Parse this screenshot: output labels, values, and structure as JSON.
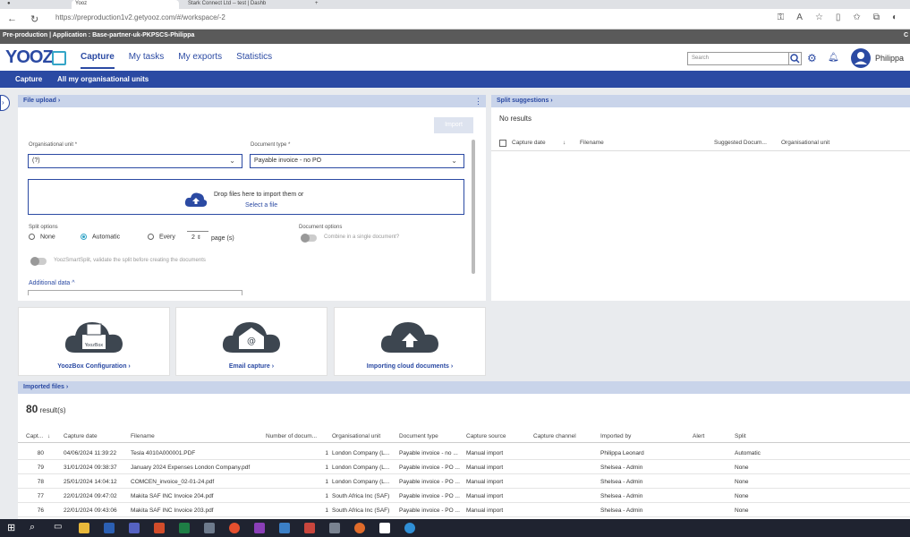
{
  "browser": {
    "tabs": [
      "Yooz",
      "Stark Connect Ltd -- test | Dashb"
    ],
    "url": "https://preproduction1v2.getyooz.com/#/workspace/-2"
  },
  "environment": {
    "text": "Pre-production | Application : Base-partner-uk-PKPSCS-Philippa",
    "right": "C"
  },
  "header": {
    "logo": "YOOZ",
    "nav": [
      "Capture",
      "My tasks",
      "My exports",
      "Statistics"
    ],
    "search_placeholder": "Search",
    "user": "Philippa"
  },
  "subnav": [
    "Capture",
    "All my organisational units"
  ],
  "file_upload": {
    "title": "File upload",
    "import_label": "Import",
    "org_unit_label": "Organisational unit *",
    "org_unit_value": "(?)",
    "doc_type_label": "Document type *",
    "doc_type_value": "Payable invoice - no PO",
    "drop_text": "Drop files here to import them or",
    "select_link": "Select a file",
    "split_options_label": "Split options",
    "split_none": "None",
    "split_automatic": "Automatic",
    "split_every": "Every",
    "every_value": "2",
    "every_unit": "page (s)",
    "doc_options_label": "Document options",
    "combine_label": "Combine in a single document?",
    "smartsplit_label": "YoozSmartSplit, validate the split before creating the documents",
    "additional_data": "Additional data"
  },
  "split_suggestions": {
    "title": "Split suggestions",
    "no_results": "No results",
    "columns": [
      "Capture date",
      "Filename",
      "Suggested Docum...",
      "Organisational unit"
    ]
  },
  "cards": [
    {
      "caption": "YoozBox Configuration",
      "icon": "printer-cloud-icon",
      "badge": "YoozBox"
    },
    {
      "caption": "Email capture",
      "icon": "email-cloud-icon",
      "badge": "@"
    },
    {
      "caption": "Importing cloud documents",
      "icon": "upload-cloud-icon"
    }
  ],
  "imported_files": {
    "title": "Imported files",
    "count": "80",
    "count_suffix": "result(s)",
    "columns": [
      "Capt...",
      "Capture date",
      "Filename",
      "Number of docum...",
      "Organisational unit",
      "Document type",
      "Capture source",
      "Capture channel",
      "Imported by",
      "Alert",
      "Split"
    ],
    "rows": [
      {
        "id": "80",
        "date": "04/06/2024 11:39:22",
        "file": "Tesla 4010A000001.PDF",
        "num": "1",
        "org": "London Company (L...",
        "type": "Payable invoice - no ...",
        "source": "Manual import",
        "channel": "",
        "by": "Philippa Leonard",
        "alert": "",
        "split": "Automatic"
      },
      {
        "id": "79",
        "date": "31/01/2024 09:38:37",
        "file": "January 2024 Expenses London Company.pdf",
        "num": "1",
        "org": "London Company (L...",
        "type": "Payable invoice - PO ...",
        "source": "Manual import",
        "channel": "",
        "by": "Shelsea - Admin",
        "alert": "",
        "split": "None"
      },
      {
        "id": "78",
        "date": "25/01/2024 14:04:12",
        "file": "COMCEN_invoice_02-01-24.pdf",
        "num": "1",
        "org": "London Company (L...",
        "type": "Payable invoice - PO ...",
        "source": "Manual import",
        "channel": "",
        "by": "Shelsea - Admin",
        "alert": "",
        "split": "None"
      },
      {
        "id": "77",
        "date": "22/01/2024 09:47:02",
        "file": "Makita SAF INC Invoice 204.pdf",
        "num": "1",
        "org": "South Africa Inc (SAF)",
        "type": "Payable invoice - PO ...",
        "source": "Manual import",
        "channel": "",
        "by": "Shelsea - Admin",
        "alert": "",
        "split": "None"
      },
      {
        "id": "76",
        "date": "22/01/2024 09:43:06",
        "file": "Makita SAF INC Invoice 203.pdf",
        "num": "1",
        "org": "South Africa Inc (SAF)",
        "type": "Payable invoice - PO ...",
        "source": "Manual import",
        "channel": "",
        "by": "Shelsea - Admin",
        "alert": "",
        "split": "None"
      }
    ]
  },
  "colors": {
    "brand": "#2b4aa3",
    "accent": "#34a5c7",
    "panel_head": "#c9d4ea"
  }
}
